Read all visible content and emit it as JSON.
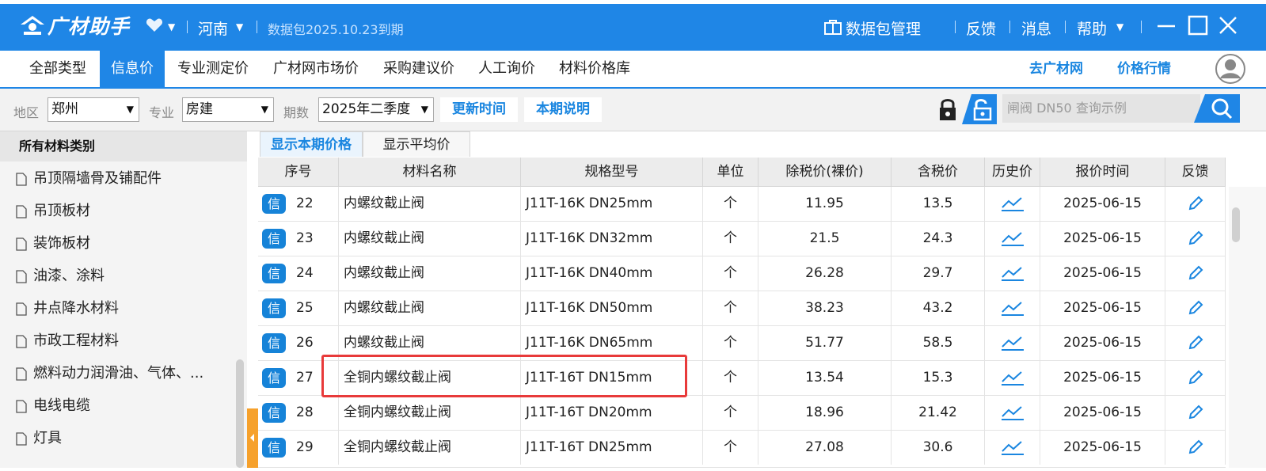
{
  "app": {
    "logo_text": "广材助手",
    "region": "河南",
    "datapack_expiry": "数据包2025.10.23到期",
    "datapack_manage": "数据包管理",
    "feedback": "反馈",
    "messages": "消息",
    "help": "帮助",
    "brand_color": "#1f86e6"
  },
  "menu": {
    "items": [
      {
        "label": "全部类型"
      },
      {
        "label": "信息价"
      },
      {
        "label": "专业测定价"
      },
      {
        "label": "广材网市场价"
      },
      {
        "label": "采购建议价"
      },
      {
        "label": "人工询价"
      },
      {
        "label": "材料价格库"
      }
    ],
    "active_index": 1,
    "link_guangcai": "去广材网",
    "link_trend": "价格行情"
  },
  "filters": {
    "region_label": "地区",
    "region_value": "郑州",
    "major_label": "专业",
    "major_value": "房建",
    "period_label": "期数",
    "period_value": "2025年二季度",
    "update_time_btn": "更新时间",
    "period_note_btn": "本期说明",
    "search_placeholder": "闸阀 DN50 查询示例"
  },
  "sidebar": {
    "header": "所有材料类别",
    "items": [
      "吊顶隔墙骨及铺配件",
      "吊顶板材",
      "装饰板材",
      "油漆、涂料",
      "井点降水材料",
      "市政工程材料",
      "燃料动力润滑油、气体、...",
      "电线电缆",
      "灯具"
    ]
  },
  "tabs": {
    "current": "显示本期价格",
    "average": "显示平均价"
  },
  "table": {
    "headers": [
      "序号",
      "材料名称",
      "规格型号",
      "单位",
      "除税价(裸价)",
      "含税价",
      "历史价",
      "报价时间",
      "反馈"
    ],
    "badge_text": "信",
    "rows": [
      {
        "no": "22",
        "name": "内螺纹截止阀",
        "spec": "J11T-16K DN25mm",
        "unit": "个",
        "price_ex": "11.95",
        "price_in": "13.5",
        "date": "2025-06-15"
      },
      {
        "no": "23",
        "name": "内螺纹截止阀",
        "spec": "J11T-16K DN32mm",
        "unit": "个",
        "price_ex": "21.5",
        "price_in": "24.3",
        "date": "2025-06-15"
      },
      {
        "no": "24",
        "name": "内螺纹截止阀",
        "spec": "J11T-16K DN40mm",
        "unit": "个",
        "price_ex": "26.28",
        "price_in": "29.7",
        "date": "2025-06-15"
      },
      {
        "no": "25",
        "name": "内螺纹截止阀",
        "spec": "J11T-16K DN50mm",
        "unit": "个",
        "price_ex": "38.23",
        "price_in": "43.2",
        "date": "2025-06-15"
      },
      {
        "no": "26",
        "name": "内螺纹截止阀",
        "spec": "J11T-16K DN65mm",
        "unit": "个",
        "price_ex": "51.77",
        "price_in": "58.5",
        "date": "2025-06-15"
      },
      {
        "no": "27",
        "name": "全铜内螺纹截止阀",
        "spec": "J11T-16T DN15mm",
        "unit": "个",
        "price_ex": "13.54",
        "price_in": "15.3",
        "date": "2025-06-15"
      },
      {
        "no": "28",
        "name": "全铜内螺纹截止阀",
        "spec": "J11T-16T DN20mm",
        "unit": "个",
        "price_ex": "18.96",
        "price_in": "21.42",
        "date": "2025-06-15"
      },
      {
        "no": "29",
        "name": "全铜内螺纹截止阀",
        "spec": "J11T-16T DN25mm",
        "unit": "个",
        "price_ex": "27.08",
        "price_in": "30.6",
        "date": "2025-06-15"
      }
    ],
    "highlight_color": "#e83a3a"
  }
}
